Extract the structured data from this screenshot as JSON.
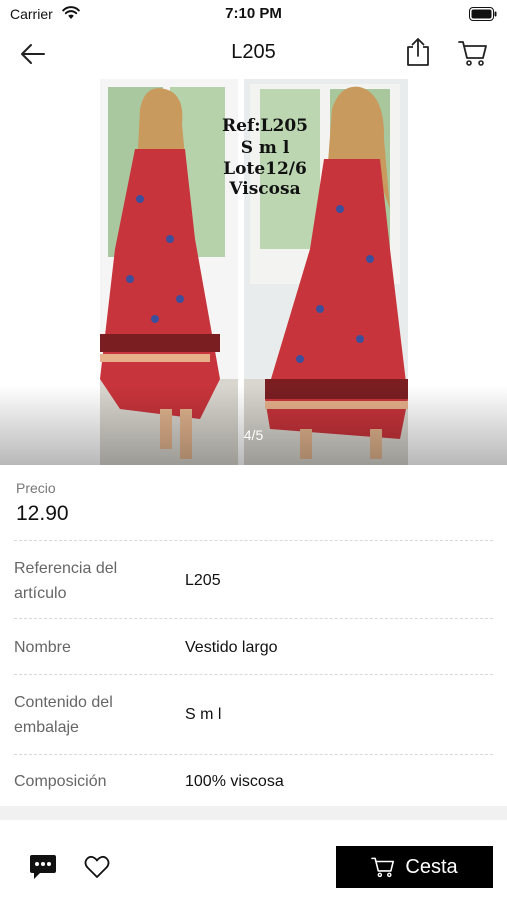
{
  "status_bar": {
    "carrier": "Carrier",
    "time": "7:10 PM",
    "icons": [
      "wifi-icon",
      "battery-icon"
    ]
  },
  "nav": {
    "title": "L205",
    "icons": [
      "back-arrow-icon",
      "share-icon",
      "cart-icon"
    ]
  },
  "gallery": {
    "counter": "4/5",
    "current_image": 4,
    "total_images": 5,
    "overlay_text": [
      "Ref:L205",
      "S m l",
      "Lote12/6",
      "Viscosa"
    ]
  },
  "price": {
    "label": "Precio",
    "value": "12.90"
  },
  "attributes": [
    {
      "label": "Referencia del artículo",
      "value": "L205"
    },
    {
      "label": "Nombre",
      "value": "Vestido largo"
    },
    {
      "label": "Contenido del embalaje",
      "value": "S m l"
    },
    {
      "label": "Composición",
      "value": "100% viscosa"
    }
  ],
  "bottom_bar": {
    "basket_label": "Cesta",
    "icons": [
      "chat-icon",
      "heart-icon",
      "cart-icon"
    ]
  },
  "colors": {
    "dress_red": "#c8343b",
    "button_black": "#000000",
    "separator_band": "#f1f1f1"
  }
}
